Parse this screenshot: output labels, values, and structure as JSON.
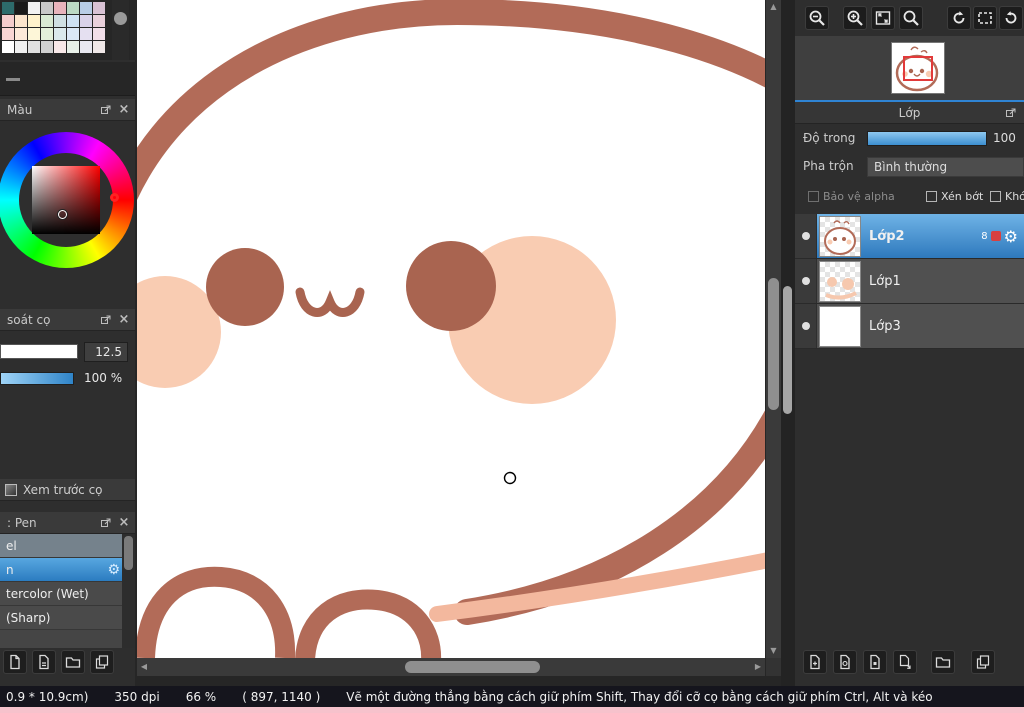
{
  "colors": {
    "accent_blue": "#3f94d8",
    "outline_brown": "#b26b58",
    "blush_salmon": "#f9ccb2",
    "eye_brown": "#a96450",
    "status_pink": "#f6c2cc"
  },
  "left_panel": {
    "palette_swatches": [
      "#2d6b6b",
      "#1a1a1a",
      "#f2f2f2",
      "#c8c8c8",
      "#e8b4bc",
      "#bcd9c4",
      "#b8cde6",
      "#d9c2d4",
      "#f4cccc",
      "#fce5cd",
      "#fff2cc",
      "#d9ead3",
      "#d0e0e3",
      "#cfe2f3",
      "#d9d2e9",
      "#ead1dc",
      "#f9d5d3",
      "#fde9d9",
      "#fdf6d8",
      "#e3f0da",
      "#dbe9ec",
      "#dbe8f6",
      "#e5e0f1",
      "#f2dfe9",
      "#ffffff",
      "#f0f0f0",
      "#e0e0e0",
      "#d0d0d0",
      "#f8e8e8",
      "#e8f0e8",
      "#e8e8f0",
      "#f0e8e8"
    ],
    "color_panel_title": "Màu",
    "brush_control_title": "soát cọ",
    "brush_size_value": "12.5",
    "brush_opacity_value": "100 %",
    "preview_button_label": "Xem trước cọ",
    "brush_list_title": ": Pen",
    "brush_items": [
      {
        "label": "el"
      },
      {
        "label": "n",
        "selected": true
      },
      {
        "label": "tercolor (Wet)"
      },
      {
        "label": "(Sharp)"
      }
    ],
    "toolbar_icons": [
      "new-document",
      "save",
      "folder",
      "copy"
    ]
  },
  "right_panel": {
    "toolbar_icons": [
      "zoom-out",
      "zoom-in",
      "fit-screen",
      "zoom-reset",
      "rotate-left",
      "select-area",
      "rotate-right"
    ],
    "layer_panel_title": "Lớp",
    "opacity_label": "Độ trong",
    "opacity_value": "100",
    "blend_label": "Pha trộn",
    "blend_mode": "Bình thường",
    "checkbox_alpha": "Bảo vệ alpha",
    "checkbox_clip": "Xén bớt",
    "checkbox_lock": "Khó",
    "layers": [
      {
        "name": "Lớp2",
        "badge": "8",
        "selected": true,
        "visible": true
      },
      {
        "name": "Lớp1",
        "selected": false,
        "visible": true
      },
      {
        "name": "Lớp3",
        "selected": false,
        "visible": true
      }
    ],
    "bottom_toolbar_icons": [
      "add-layer",
      "add-8bit-layer",
      "add-1bit-layer",
      "transfer-layer",
      "add-folder",
      "duplicate-layer"
    ]
  },
  "status_bar": {
    "size_info": "0.9 * 10.9cm)",
    "dpi": "350 dpi",
    "zoom": "66 %",
    "coords": "( 897, 1140 )",
    "hint": "Vẽ một đường thẳng bằng cách giữ phím Shift, Thay đổi cỡ cọ bằng cách giữ phím Ctrl, Alt và kéo"
  },
  "glyphs": {
    "scroll_up": "▲",
    "scroll_down": "▼",
    "scroll_left": "◀",
    "scroll_right": "▶",
    "close": "×",
    "gear": "⚙"
  }
}
